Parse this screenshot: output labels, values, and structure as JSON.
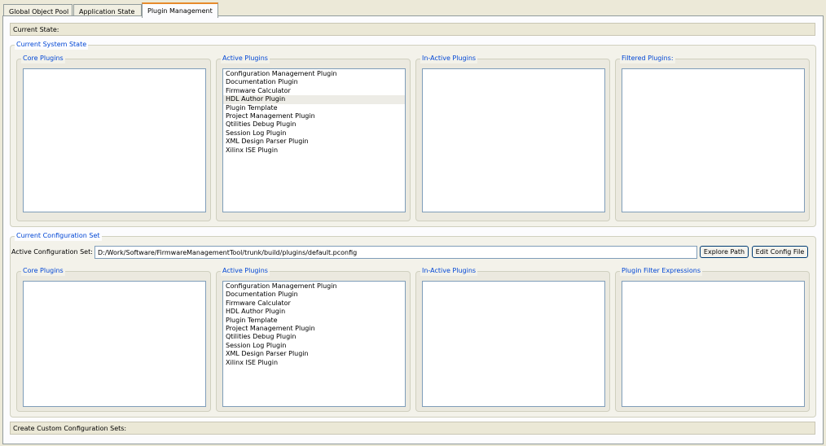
{
  "tabs": [
    {
      "label": "Global Object Pool"
    },
    {
      "label": "Application State"
    },
    {
      "label": "Plugin Management"
    }
  ],
  "current_state_label": "Current State:",
  "system_state": {
    "title": "Current System State",
    "panels": [
      {
        "title": "Core Plugins",
        "items": []
      },
      {
        "title": "Active Plugins",
        "items": [
          "Configuration Management Plugin",
          "Documentation Plugin",
          "Firmware Calculator",
          "HDL Author Plugin",
          "Plugin Template",
          "Project Management Plugin",
          "Qtilities Debug Plugin",
          "Session Log Plugin",
          "XML Design Parser Plugin",
          "Xilinx ISE Plugin"
        ]
      },
      {
        "title": "In-Active Plugins",
        "items": []
      },
      {
        "title": "Filtered Plugins:",
        "items": []
      }
    ]
  },
  "config_set": {
    "title": "Current Configuration Set",
    "active_label": "Active Configuration Set:",
    "path_value": "D:/Work/Software/FirmwareManagementTool/trunk/build/plugins/default.pconfig",
    "explore_label": "Explore Path",
    "edit_label": "Edit Config File",
    "panels": [
      {
        "title": "Core Plugins",
        "items": []
      },
      {
        "title": "Active Plugins",
        "items": [
          "Configuration Management Plugin",
          "Documentation Plugin",
          "Firmware Calculator",
          "HDL Author Plugin",
          "Plugin Template",
          "Project Management Plugin",
          "Qtilities Debug Plugin",
          "Session Log Plugin",
          "XML Design Parser Plugin",
          "Xilinx ISE Plugin"
        ]
      },
      {
        "title": "In-Active Plugins",
        "items": []
      },
      {
        "title": "Plugin Filter Expressions",
        "items": []
      }
    ]
  },
  "custom_sets_label": "Create Custom Configuration Sets:"
}
